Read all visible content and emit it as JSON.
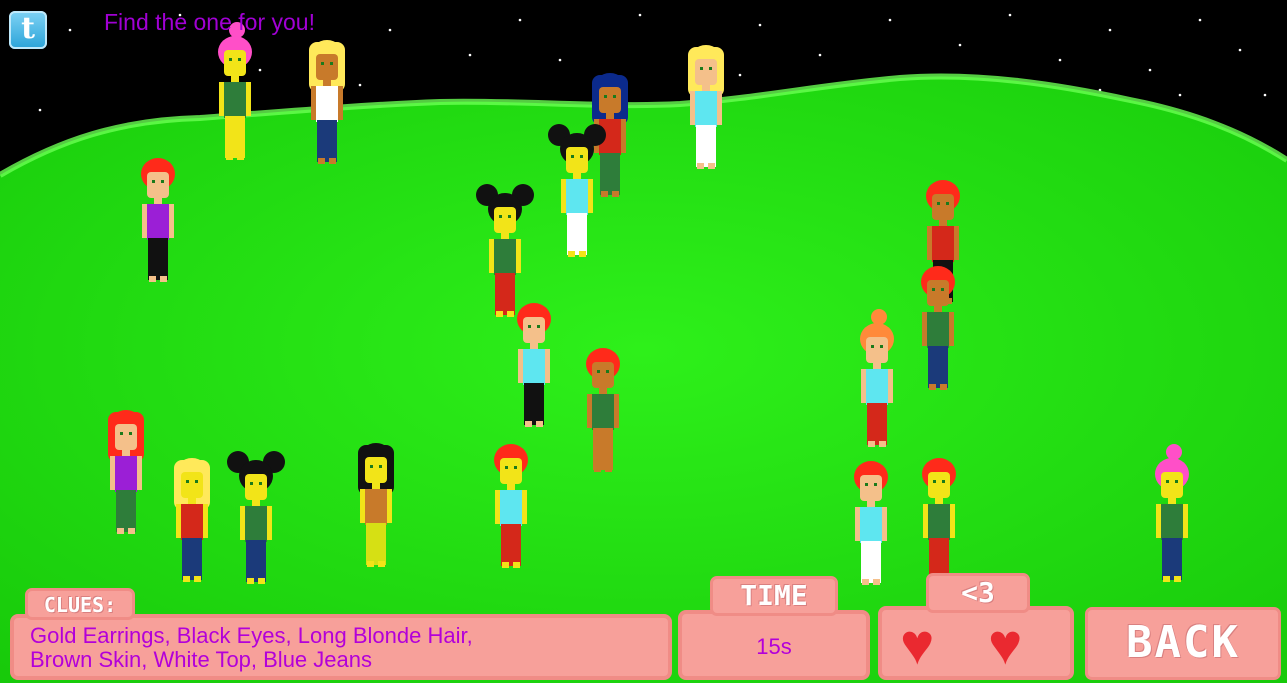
{
  "tagline": "Find the one for you!",
  "twitter": {
    "icon": "twitter-bird-icon",
    "glyph": "t"
  },
  "clues": {
    "label": "CLUES:",
    "text": "Gold Earrings, Black Eyes, Long Blonde Hair,\nBrown Skin, White Top, Blue Jeans"
  },
  "time": {
    "label": "TIME",
    "value": "15s"
  },
  "lives": {
    "label": "<3",
    "hearts": [
      "♥",
      "♥"
    ]
  },
  "back_label": "BACK",
  "colors": {
    "grass": "#22e30f",
    "sky": "#000000",
    "panel": "#f7a09a",
    "clue_text": "#b300d9",
    "tagline": "#a100d4"
  },
  "characters": [
    {
      "hair": "#ff4fc8",
      "skin": "#f2e418",
      "top": "#2e7d3a",
      "bottom": "#f2e418",
      "style": "bun"
    },
    {
      "hair": "#ffe95a",
      "skin": "#c87a2a",
      "top": "#ffffff",
      "bottom": "#1b3a7a",
      "style": "long"
    },
    {
      "hair": "#0b2a8c",
      "skin": "#c87a2a",
      "top": "#d4281a",
      "bottom": "#2e7d3a",
      "style": "long"
    },
    {
      "hair": "#ffe95a",
      "skin": "#f4c08a",
      "top": "#5ee6f0",
      "bottom": "#ffffff",
      "style": "long"
    },
    {
      "hair": "#ff2a1a",
      "skin": "#f4c08a",
      "top": "#9b1fd6",
      "bottom": "#111111",
      "style": "short"
    },
    {
      "hair": "#111111",
      "skin": "#f2e418",
      "top": "#5ee6f0",
      "bottom": "#ffffff",
      "style": "puffs"
    },
    {
      "hair": "#111111",
      "skin": "#f2e418",
      "top": "#2e7d3a",
      "bottom": "#d4281a",
      "style": "puffs"
    },
    {
      "hair": "#ff2a1a",
      "skin": "#c87a2a",
      "top": "#d4281a",
      "bottom": "#111111",
      "style": "short"
    },
    {
      "hair": "#ff2a1a",
      "skin": "#c87a2a",
      "top": "#2e7d3a",
      "bottom": "#1b3a7a",
      "style": "short"
    },
    {
      "hair": "#ff2a1a",
      "skin": "#f4c08a",
      "top": "#5ee6f0",
      "bottom": "#111111",
      "style": "short"
    },
    {
      "hair": "#ff2a1a",
      "skin": "#c87a2a",
      "top": "#2e7d3a",
      "bottom": "#c87a2a",
      "style": "short"
    },
    {
      "hair": "#ff8a3a",
      "skin": "#f4c08a",
      "top": "#5ee6f0",
      "bottom": "#d4281a",
      "style": "bun"
    },
    {
      "hair": "#ff2a1a",
      "skin": "#f4c08a",
      "top": "#9b1fd6",
      "bottom": "#2e7d3a",
      "style": "long"
    },
    {
      "hair": "#ffe95a",
      "skin": "#f2e418",
      "top": "#d4281a",
      "bottom": "#1b3a7a",
      "style": "long"
    },
    {
      "hair": "#111111",
      "skin": "#f2e418",
      "top": "#2e7d3a",
      "bottom": "#1b3a7a",
      "style": "puffs"
    },
    {
      "hair": "#111111",
      "skin": "#f2e418",
      "top": "#c87a2a",
      "bottom": "#d6e014",
      "style": "long"
    },
    {
      "hair": "#ff2a1a",
      "skin": "#f2e418",
      "top": "#5ee6f0",
      "bottom": "#d4281a",
      "style": "short"
    },
    {
      "hair": "#ff2a1a",
      "skin": "#f4c08a",
      "top": "#5ee6f0",
      "bottom": "#ffffff",
      "style": "short"
    },
    {
      "hair": "#ff2a1a",
      "skin": "#f2e418",
      "top": "#2e7d3a",
      "bottom": "#d4281a",
      "style": "short"
    },
    {
      "hair": "#ff4fc8",
      "skin": "#f2e418",
      "top": "#2e7d3a",
      "bottom": "#1b3a7a",
      "style": "bun"
    }
  ]
}
